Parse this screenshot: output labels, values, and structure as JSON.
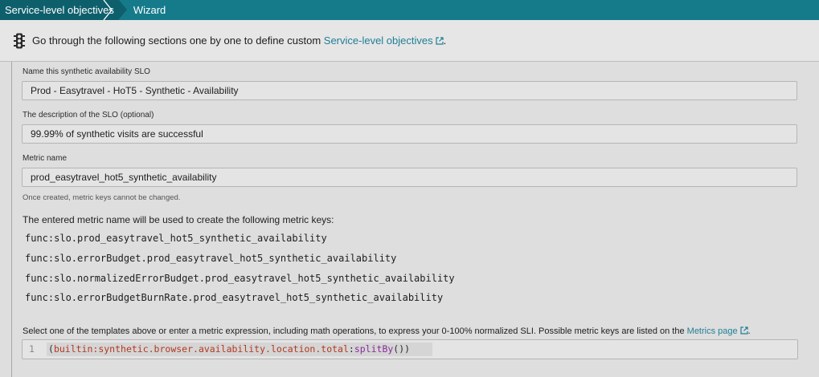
{
  "breadcrumb": {
    "items": [
      "Service-level objectives",
      "Wizard"
    ]
  },
  "banner": {
    "text_prefix": "Go through the following sections one by one to define custom ",
    "link_text": "Service-level objectives",
    "text_suffix": "."
  },
  "form": {
    "name": {
      "label": "Name this synthetic availability SLO",
      "value": "Prod - Easytravel - HoT5 - Synthetic - Availability"
    },
    "description": {
      "label": "The description of the SLO (optional)",
      "value": "99.99% of synthetic visits are successful"
    },
    "metric": {
      "label": "Metric name",
      "value": "prod_easytravel_hot5_synthetic_availability",
      "hint": "Once created, metric keys cannot be changed."
    },
    "metric_keys_intro": "The entered metric name will be used to create the following metric keys:",
    "metric_keys": [
      "func:slo.prod_easytravel_hot5_synthetic_availability",
      "func:slo.errorBudget.prod_easytravel_hot5_synthetic_availability",
      "func:slo.normalizedErrorBudget.prod_easytravel_hot5_synthetic_availability",
      "func:slo.errorBudgetBurnRate.prod_easytravel_hot5_synthetic_availability"
    ],
    "expression": {
      "intro_prefix": "Select one of the templates above or enter a metric expression, including math operations, to express your 0-100% normalized SLI. Possible metric keys are listed on the ",
      "intro_link": "Metrics page",
      "intro_suffix": ".",
      "line_number": "1",
      "open_paren": "(",
      "metric": "builtin:synthetic.browser.availability.location.total",
      "colon": ":",
      "func": "splitBy",
      "close": "())"
    }
  },
  "colors": {
    "header": "#157b8b",
    "link": "#1f7f96"
  },
  "icons": [
    "traffic-light-icon",
    "external-link-icon"
  ]
}
